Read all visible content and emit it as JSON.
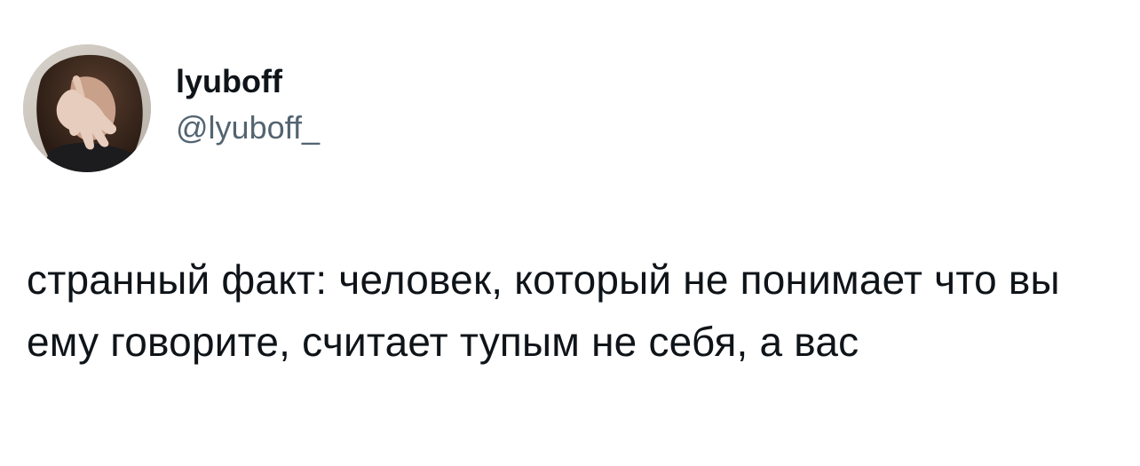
{
  "author": {
    "display_name": "lyuboff",
    "handle": "@lyuboff_",
    "avatar_icon": "profile-photo"
  },
  "tweet": {
    "text": "странный факт: человек, который не понимает что вы ему говорите, считает тупым не себя, а вас"
  },
  "colors": {
    "text": "#0f1419",
    "secondary": "#536471",
    "background": "#ffffff"
  }
}
